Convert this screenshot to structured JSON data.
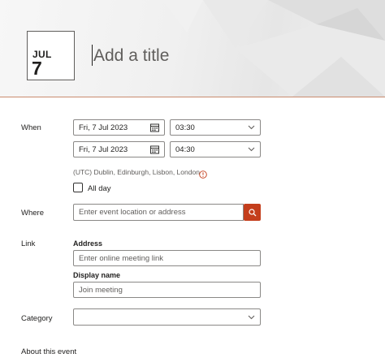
{
  "header": {
    "month": "JUL",
    "day": "7",
    "title_placeholder": "Add a title"
  },
  "when": {
    "label": "When",
    "start_date": "Fri, 7 Jul 2023",
    "start_time": "03:30",
    "end_date": "Fri, 7 Jul 2023",
    "end_time": "04:30",
    "timezone": "(UTC) Dublin, Edinburgh, Lisbon, London",
    "all_day_label": "All day",
    "all_day_checked": false
  },
  "where": {
    "label": "Where",
    "placeholder": "Enter event location or address"
  },
  "link": {
    "label": "Link",
    "address_label": "Address",
    "address_placeholder": "Enter online meeting link",
    "display_name_label": "Display name",
    "display_name_placeholder": "Join meeting"
  },
  "category": {
    "label": "Category",
    "value": ""
  },
  "about": {
    "label": "About this event"
  },
  "colors": {
    "accent": "#c43e1c",
    "border": "#8a8886",
    "text": "#201f1e",
    "muted": "#605e5c"
  },
  "icons": {
    "calendar": "calendar-icon",
    "chevron": "chevron-down-icon",
    "info": "info-icon",
    "search": "search-icon"
  }
}
